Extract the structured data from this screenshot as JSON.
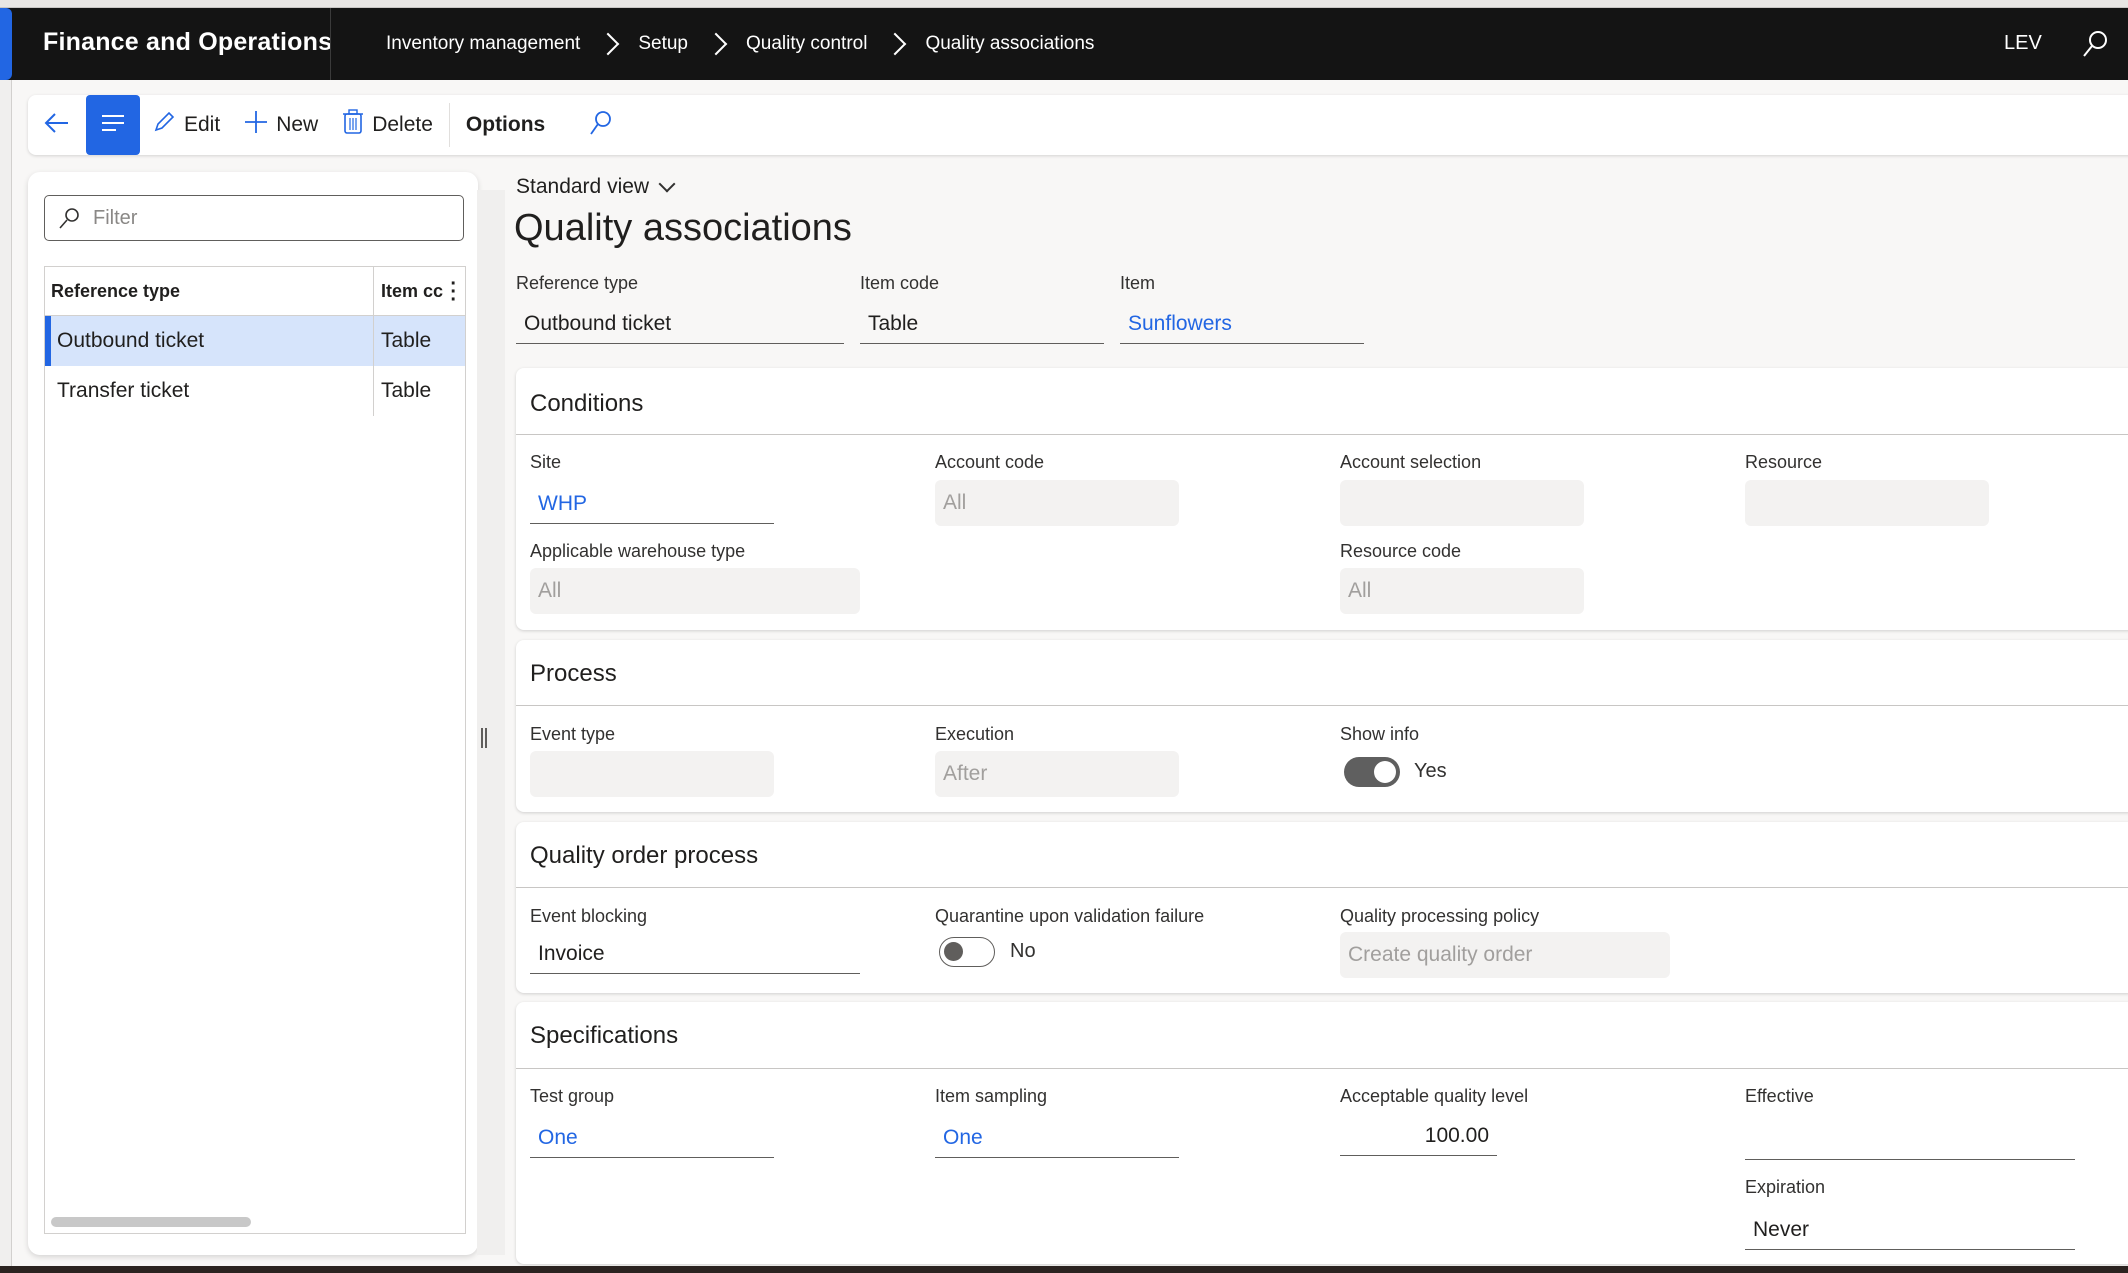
{
  "header": {
    "app_title": "Finance and Operations",
    "breadcrumbs": [
      "Inventory management",
      "Setup",
      "Quality control",
      "Quality associations"
    ],
    "company": "LEV",
    "accent_color": "#2266e3"
  },
  "toolbar": {
    "back_icon": "arrow-left-icon",
    "menu_icon": "hamburger-icon",
    "edit_label": "Edit",
    "new_label": "New",
    "delete_label": "Delete",
    "options_label": "Options",
    "search_icon": "search-icon"
  },
  "list": {
    "filter_placeholder": "Filter",
    "columns": [
      "Reference type",
      "Item cc"
    ],
    "rows": [
      {
        "reference_type": "Outbound ticket",
        "item_code": "Table",
        "selected": true
      },
      {
        "reference_type": "Transfer ticket",
        "item_code": "Table",
        "selected": false
      }
    ]
  },
  "main": {
    "view_selector": "Standard view",
    "title": "Quality associations",
    "header_fields": {
      "reference_type": {
        "label": "Reference type",
        "value": "Outbound ticket"
      },
      "item_code": {
        "label": "Item code",
        "value": "Table"
      },
      "item": {
        "label": "Item",
        "value": "Sunflowers"
      }
    },
    "conditions": {
      "title": "Conditions",
      "site": {
        "label": "Site",
        "value": "WHP"
      },
      "account_code": {
        "label": "Account code",
        "value": "All"
      },
      "account_selection": {
        "label": "Account selection",
        "value": ""
      },
      "resource": {
        "label": "Resource",
        "value": ""
      },
      "applicable_warehouse_type": {
        "label": "Applicable warehouse type",
        "value": "All"
      },
      "resource_code": {
        "label": "Resource code",
        "value": "All"
      }
    },
    "process": {
      "title": "Process",
      "event_type": {
        "label": "Event type",
        "value": ""
      },
      "execution": {
        "label": "Execution",
        "value": "After"
      },
      "show_info": {
        "label": "Show info",
        "value": "Yes",
        "on": true
      }
    },
    "quality_order_process": {
      "title": "Quality order process",
      "event_blocking": {
        "label": "Event blocking",
        "value": "Invoice"
      },
      "quarantine": {
        "label": "Quarantine upon validation failure",
        "value": "No",
        "on": false
      },
      "policy": {
        "label": "Quality processing policy",
        "value": "Create quality order"
      }
    },
    "specifications": {
      "title": "Specifications",
      "test_group": {
        "label": "Test group",
        "value": "One"
      },
      "item_sampling": {
        "label": "Item sampling",
        "value": "One"
      },
      "aql": {
        "label": "Acceptable quality level",
        "value": "100.00"
      },
      "effective": {
        "label": "Effective",
        "value": ""
      },
      "expiration": {
        "label": "Expiration",
        "value": "Never"
      }
    }
  }
}
